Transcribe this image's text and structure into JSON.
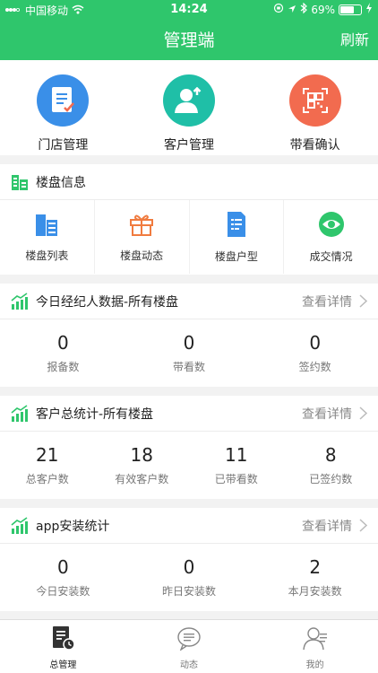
{
  "status_bar": {
    "carrier": "中国移动",
    "time": "14:24",
    "battery": "69%",
    "battery_level": 0.69
  },
  "header": {
    "title": "管理端",
    "refresh_label": "刷新"
  },
  "top_actions": [
    {
      "label": "门店管理",
      "icon": "document-list-icon",
      "color": "#3a8fe8"
    },
    {
      "label": "客户管理",
      "icon": "user-add-icon",
      "color": "#1fbfa7"
    },
    {
      "label": "带看确认",
      "icon": "qr-scan-icon",
      "color": "#f26b4f"
    }
  ],
  "building_info": {
    "title": "楼盘信息",
    "items": [
      {
        "label": "楼盘列表",
        "icon": "buildings-icon",
        "color": "#3a8fe8"
      },
      {
        "label": "楼盘动态",
        "icon": "gift-icon",
        "color": "#f07b3f"
      },
      {
        "label": "楼盘户型",
        "icon": "floorplan-doc-icon",
        "color": "#3a8fe8"
      },
      {
        "label": "成交情况",
        "icon": "eye-icon",
        "color": "#2fc66c"
      }
    ]
  },
  "agent_today": {
    "title": "今日经纪人数据-所有楼盘",
    "more": "查看详情",
    "stats": [
      {
        "value": "0",
        "label": "报备数"
      },
      {
        "value": "0",
        "label": "带看数"
      },
      {
        "value": "0",
        "label": "签约数"
      }
    ]
  },
  "customer_total": {
    "title": "客户总统计-所有楼盘",
    "more": "查看详情",
    "stats": [
      {
        "value": "21",
        "label": "总客户数"
      },
      {
        "value": "18",
        "label": "有效客户数"
      },
      {
        "value": "11",
        "label": "已带看数"
      },
      {
        "value": "8",
        "label": "已签约数"
      }
    ]
  },
  "app_install": {
    "title": "app安装统计",
    "more": "查看详情",
    "stats": [
      {
        "value": "0",
        "label": "今日安装数"
      },
      {
        "value": "0",
        "label": "昨日安装数"
      },
      {
        "value": "2",
        "label": "本月安装数"
      }
    ]
  },
  "tabbar": [
    {
      "label": "总管理",
      "icon": "management-icon",
      "active": true
    },
    {
      "label": "动态",
      "icon": "message-icon",
      "active": false
    },
    {
      "label": "我的",
      "icon": "profile-icon",
      "active": false
    }
  ],
  "colors": {
    "brand": "#2fc66c"
  }
}
